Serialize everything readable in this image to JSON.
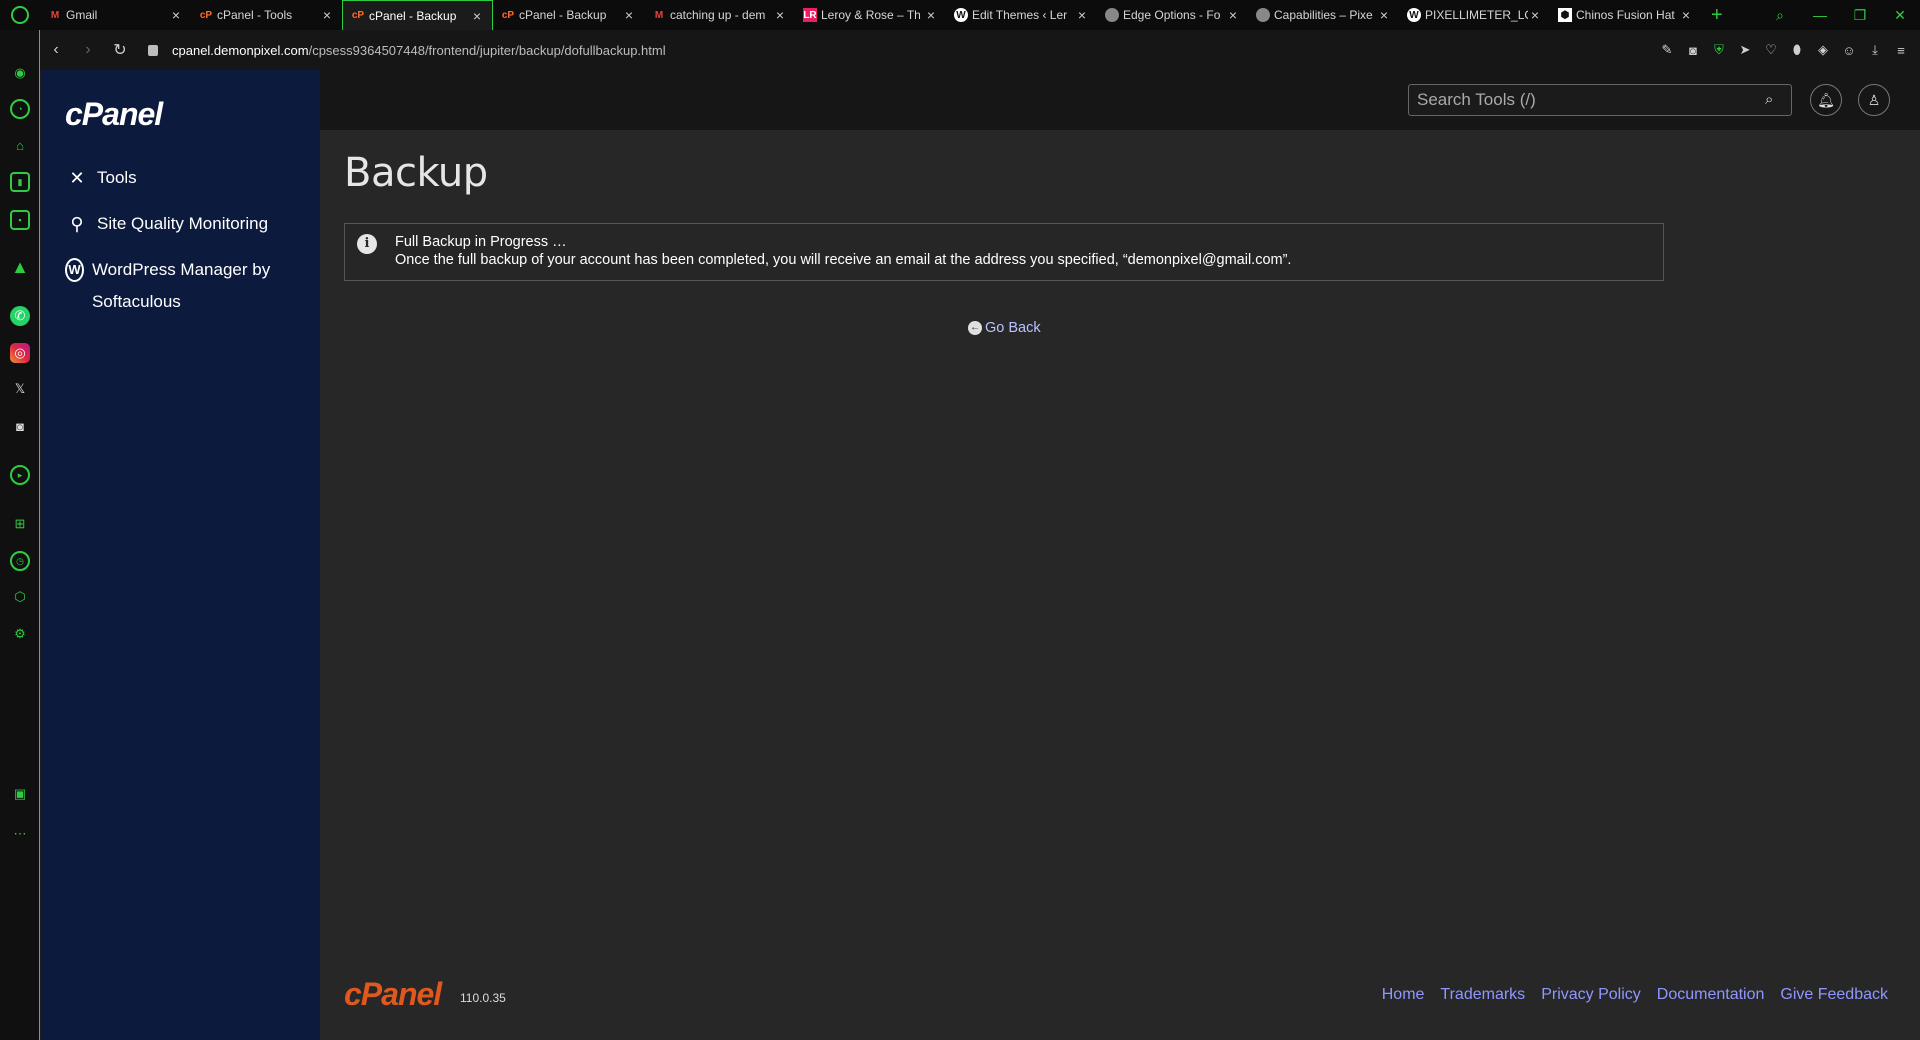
{
  "browser": {
    "tabs": [
      {
        "title": "Gmail",
        "favicon": "gmail-icon",
        "active": false
      },
      {
        "title": "cPanel - Tools",
        "favicon": "cpanel-icon",
        "active": false
      },
      {
        "title": "cPanel - Backup",
        "favicon": "cpanel-icon",
        "active": true
      },
      {
        "title": "cPanel - Backup",
        "favicon": "cpanel-icon",
        "active": false
      },
      {
        "title": "catching up - dem",
        "favicon": "gmail-icon",
        "active": false
      },
      {
        "title": "Leroy & Rose – Th",
        "favicon": "leroy-rose-icon",
        "active": false
      },
      {
        "title": "Edit Themes ‹ Ler",
        "favicon": "wordpress-icon",
        "active": false
      },
      {
        "title": "Edge Options - Fo",
        "favicon": "globe-icon",
        "active": false
      },
      {
        "title": "Capabilities – Pixe",
        "favicon": "globe-icon",
        "active": false
      },
      {
        "title": "PIXELLIMETER_LO",
        "favicon": "wordpress-icon",
        "active": false
      },
      {
        "title": "Chinos Fusion Hat",
        "favicon": "shopify-icon",
        "active": false
      }
    ],
    "url_host": "cpanel.demonpixel.com",
    "url_path": "/cpsess9364507448/frontend/jupiter/backup/dofullbackup.html",
    "accent_color": "#2ecc40"
  },
  "cpanel": {
    "logo": "cPanel",
    "nav": [
      {
        "label": "Tools",
        "icon": "tools-icon"
      },
      {
        "label": "Site Quality Monitoring",
        "icon": "site-quality-icon"
      },
      {
        "label": "WordPress Manager by Softaculous",
        "icon": "wordpress-icon"
      }
    ],
    "search_placeholder": "Search Tools (/)",
    "page_title": "Backup",
    "alert": {
      "title": "Full Backup in Progress …",
      "message": "Once the full backup of your account has been completed, you will receive an email at the address you specified, “demonpixel@gmail.com”."
    },
    "go_back": "Go Back",
    "footer": {
      "logo": "cPanel",
      "version": "110.0.35",
      "links": [
        "Home",
        "Trademarks",
        "Privacy Policy",
        "Documentation",
        "Give Feedback"
      ]
    },
    "colors": {
      "nav_bg": "#0c1a3d",
      "link": "#8f97ff",
      "footer_logo": "#e0581e"
    }
  }
}
